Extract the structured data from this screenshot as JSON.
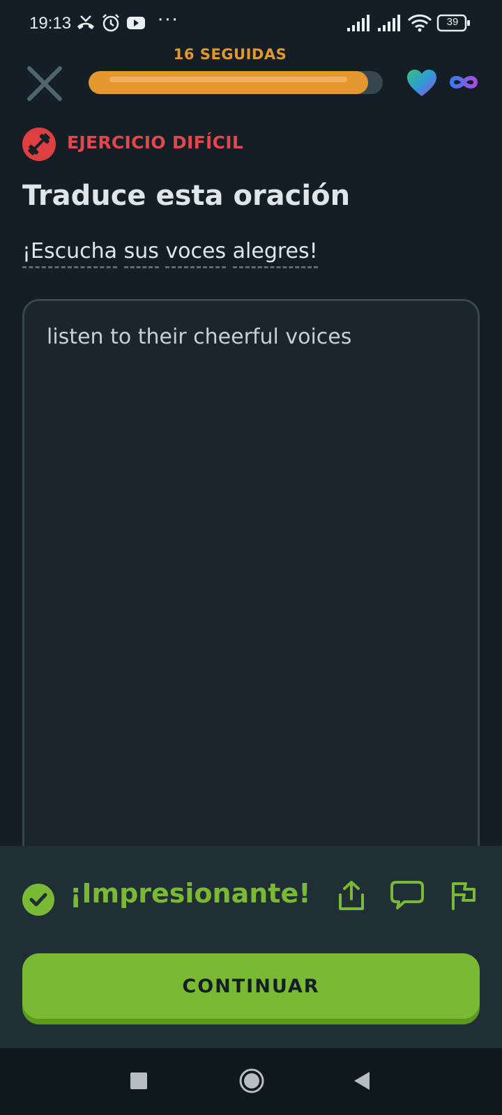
{
  "status_bar": {
    "time": "19:13",
    "battery": "39",
    "icons": [
      "missed-call-icon",
      "alarm-icon",
      "youtube-icon",
      "more-icon",
      "signal-icon",
      "signal-icon",
      "wifi-icon",
      "battery-icon"
    ]
  },
  "header": {
    "streak_label": "16 SEGUIDAS",
    "progress": 0.95,
    "hearts": "infinite"
  },
  "challenge": {
    "badge_label": "EJERCICIO DIFÍCIL",
    "title": "Traduce esta oración",
    "prompt_words": [
      "¡Escucha",
      "sus",
      "voces",
      "alegres!"
    ]
  },
  "answer": {
    "text": "listen to their cheerful voices"
  },
  "feedback": {
    "title": "¡Impresionante!",
    "continue_label": "CONTINUAR"
  },
  "colors": {
    "background": "#131f24",
    "accent_orange": "#e5972f",
    "hard_red": "#e5464d",
    "success_green": "#79b933",
    "panel": "#202f36"
  }
}
